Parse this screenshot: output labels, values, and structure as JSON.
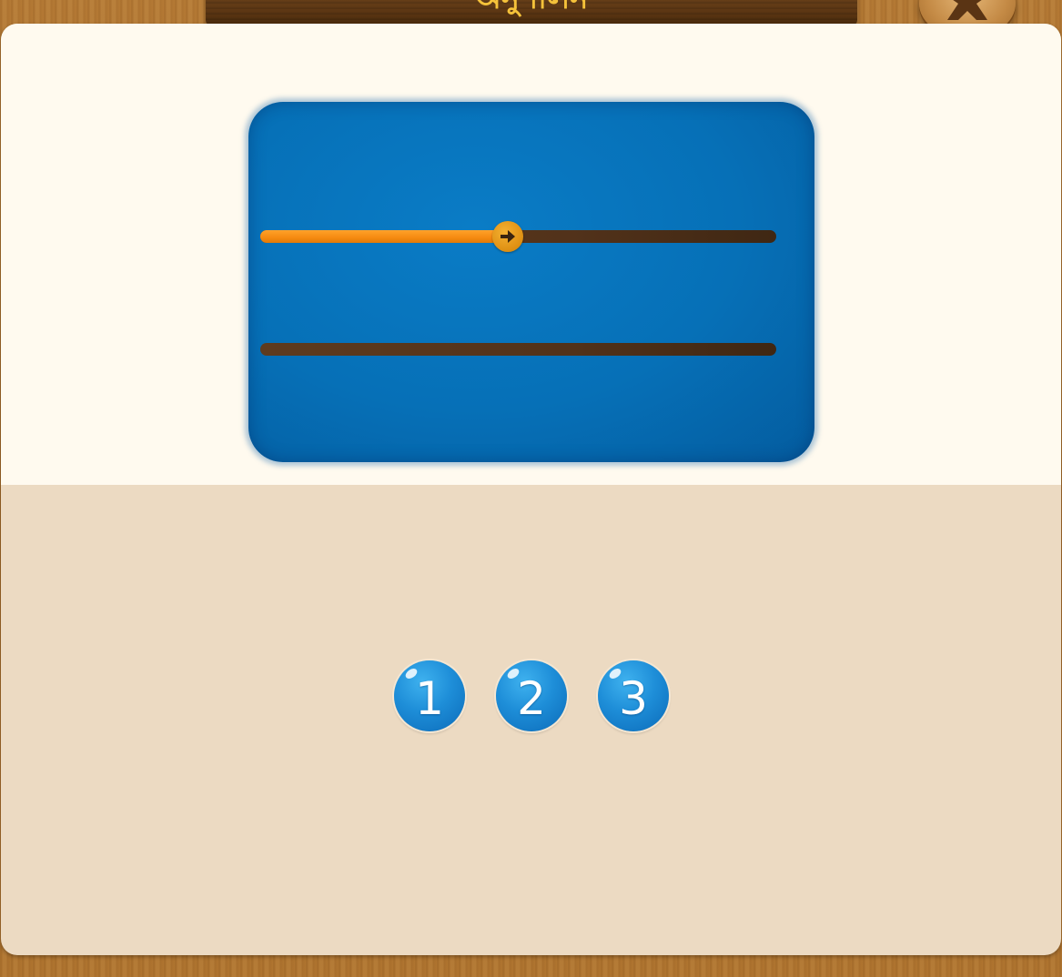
{
  "header": {
    "title": "অনুশীলন",
    "close_icon": "close-icon"
  },
  "colors": {
    "board_blue": "#0670b7",
    "track_brown": "#52321a",
    "progress_orange": "#f58a10",
    "level_blue": "#1e8ed8",
    "panel_cream": "#fffaef",
    "panel_beige": "#ecdac2"
  },
  "board": {
    "tracks": [
      {
        "progress": 0.48,
        "handle_icon": "arrow-right-icon"
      },
      {
        "progress": 0
      }
    ]
  },
  "levels": [
    {
      "label": "1"
    },
    {
      "label": "2"
    },
    {
      "label": "3"
    }
  ]
}
